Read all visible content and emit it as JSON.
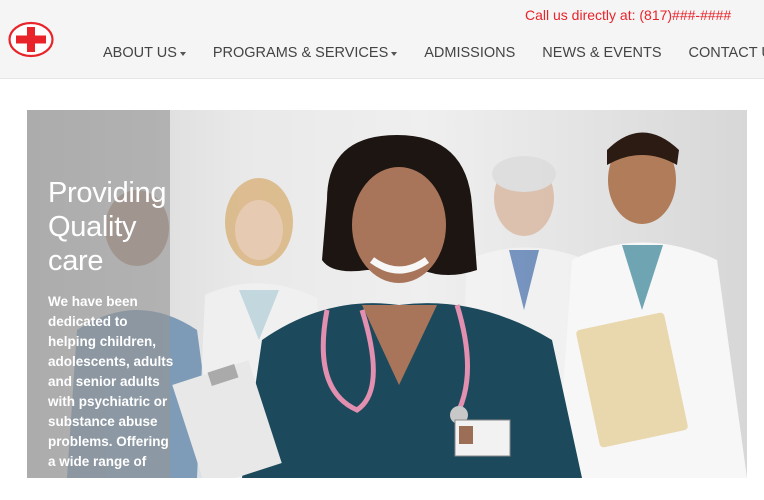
{
  "header": {
    "logo_icon": "red-cross-icon",
    "phone_text": "Call us directly at: (817)###-####",
    "accent": "#e8232a"
  },
  "nav": {
    "items": [
      {
        "label": "ABOUT US",
        "dropdown": true
      },
      {
        "label": "PROGRAMS & SERVICES",
        "dropdown": true
      },
      {
        "label": "ADMISSIONS",
        "dropdown": false
      },
      {
        "label": "NEWS & EVENTS",
        "dropdown": false
      },
      {
        "label": "CONTACT US",
        "dropdown": false
      }
    ]
  },
  "hero": {
    "title": "Providing Quality care",
    "text": "We have been dedicated to helping children, adolescents, adults and senior adults with psychiatric or substance abuse problems. Offering a wide range of",
    "image": "medical-staff-photo"
  }
}
